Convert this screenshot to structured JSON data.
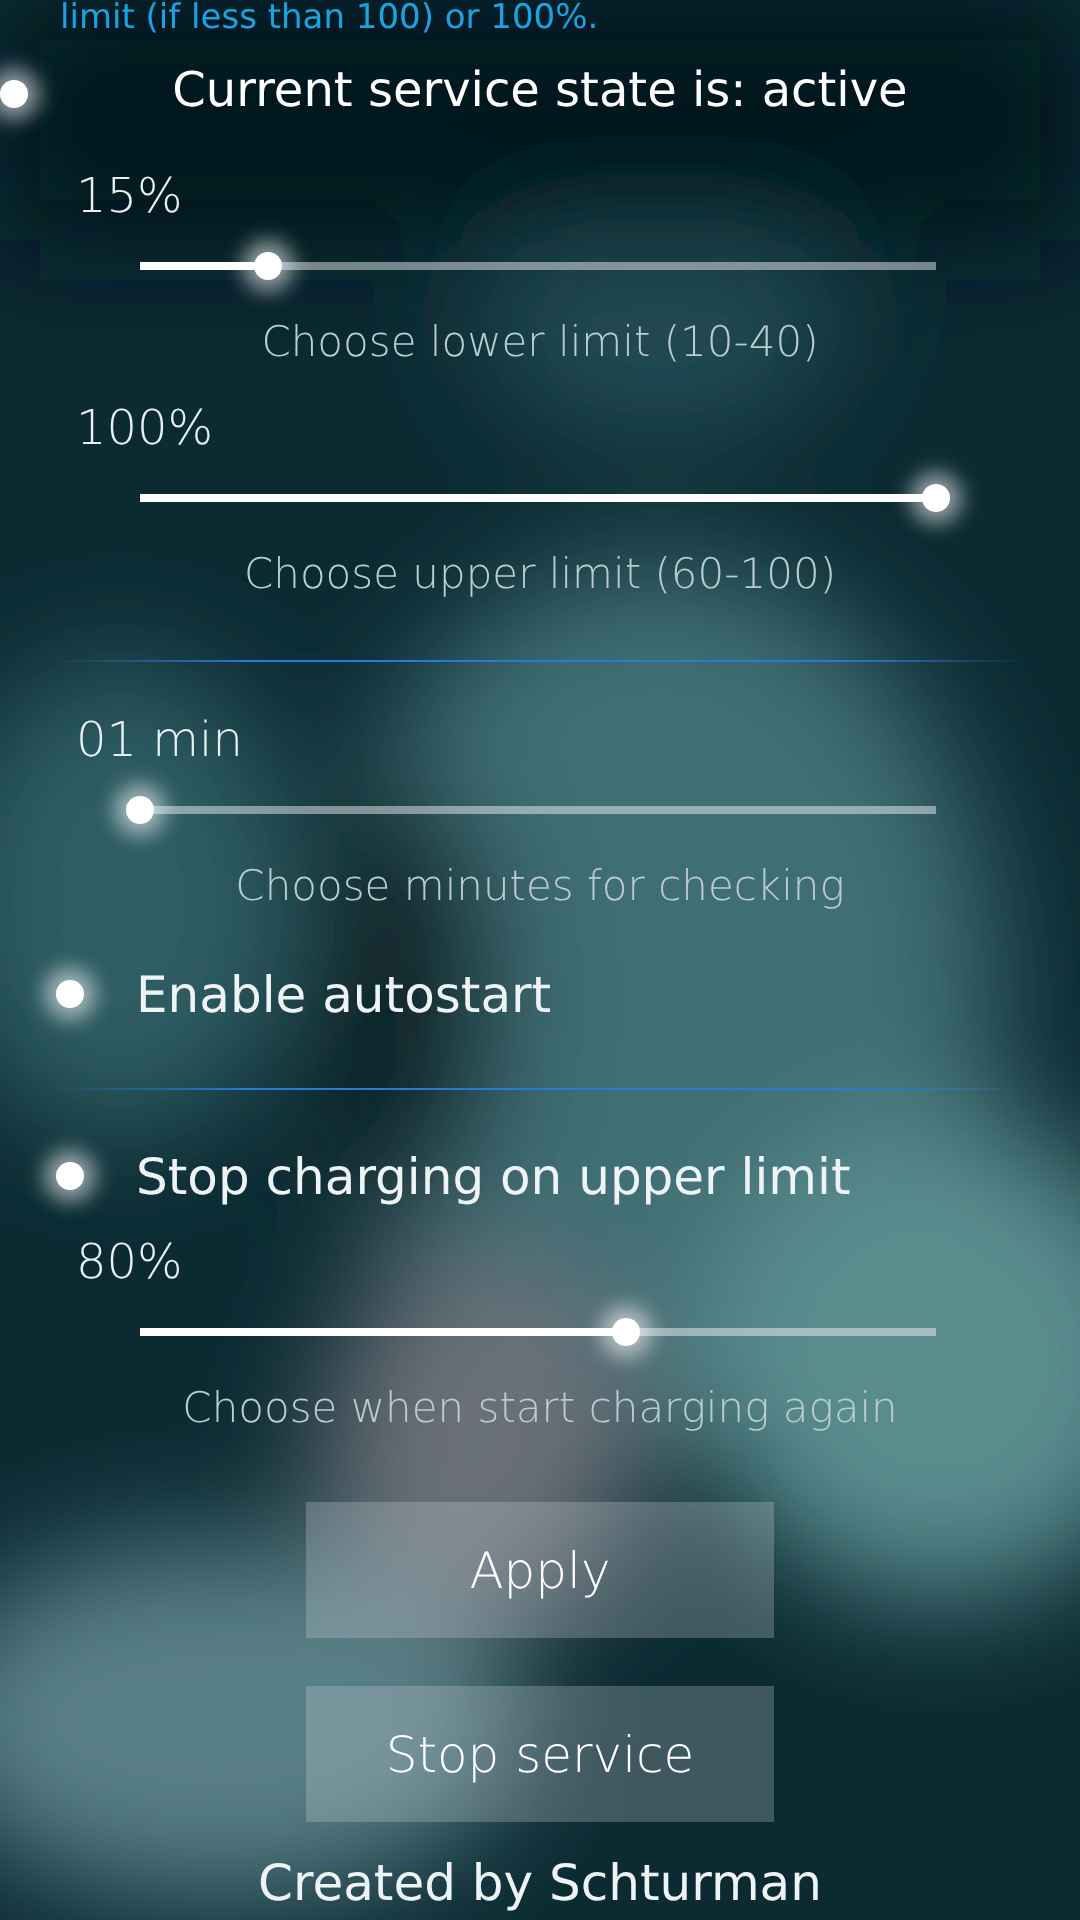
{
  "header_note": "limit (if less than 100) or 100%.",
  "service_state": "Current service state is: active",
  "controls": [
    {
      "kind": "slider",
      "reading": "15%",
      "level": 0.16,
      "caption": "Choose lower limit (10-40)"
    },
    {
      "kind": "slider",
      "reading": "100%",
      "level": 1.0,
      "caption": "Choose upper limit (60-100)"
    },
    {
      "kind": "divider"
    },
    {
      "kind": "slider",
      "reading": "01 min",
      "level": 0.0,
      "caption": "Choose minutes for checking"
    },
    {
      "kind": "switch",
      "label": "Enable autostart",
      "checked": true
    },
    {
      "kind": "divider"
    },
    {
      "kind": "switch",
      "label": "Stop charging on upper limit",
      "checked": true
    },
    {
      "kind": "slider",
      "reading": "80%",
      "level": 0.61,
      "caption": "Choose when start charging again"
    }
  ],
  "buttons": [
    "Apply",
    "Stop service"
  ],
  "footer": "Created by Schturman"
}
